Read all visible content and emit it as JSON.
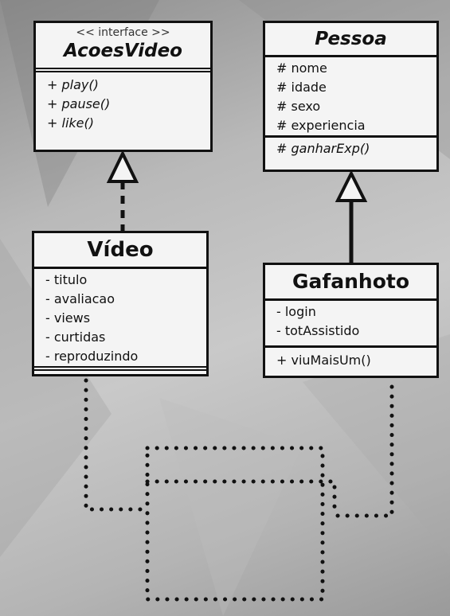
{
  "acoes_video": {
    "stereotype": "<< interface >>",
    "name": "AcoesVideo",
    "methods": [
      "+ play()",
      "+ pause()",
      "+ like()"
    ]
  },
  "pessoa": {
    "name": "Pessoa",
    "attributes": [
      "# nome",
      "# idade",
      "# sexo",
      "# experiencia"
    ],
    "methods": [
      "# ganharExp()"
    ]
  },
  "video": {
    "name": "Vídeo",
    "attributes": [
      "- titulo",
      "- avaliacao",
      "- views",
      "- curtidas",
      "- reproduzindo"
    ]
  },
  "gafanhoto": {
    "name": "Gafanhoto",
    "attributes": [
      "- login",
      "- totAssistido"
    ],
    "methods": [
      "+ viuMaisUm()"
    ]
  }
}
